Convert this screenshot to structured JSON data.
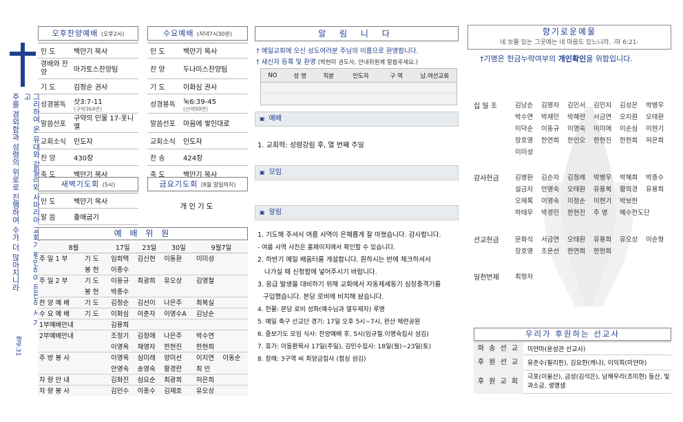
{
  "side": {
    "vertical_lines": [
      "그리하여 온 유대와 갈릴리와 사마리아 교회가 평안하여 든든히 서 가고",
      "주를 경외함과 성령의 위로로 진행하여 수가 더 많아지니라"
    ],
    "verse_ref": "행9:31"
  },
  "afternoon": {
    "title": "오후찬양예배",
    "time": "(오후2시)",
    "rows": [
      {
        "label": "인    도",
        "value": "백만기 목사",
        "sub": ""
      },
      {
        "label": "경배와 찬  양",
        "value": "아가토스찬양팀",
        "sub": ""
      },
      {
        "label": "기    도",
        "value": "김정순 권사",
        "sub": ""
      },
      {
        "label": "성경봉독",
        "value": "삿3:7-11",
        "sub": "(구약364면)"
      },
      {
        "label": "말씀선포",
        "value": "구약의 인물 17-옷니엘",
        "sub": ""
      },
      {
        "label": "교회소식",
        "value": "인도자",
        "sub": ""
      },
      {
        "label": "찬    양",
        "value": "430장",
        "sub": ""
      },
      {
        "label": "축    도",
        "value": "백만기 목사",
        "sub": ""
      }
    ]
  },
  "wednesday": {
    "title": "수요예배",
    "time": "(저녁7시30분)",
    "rows": [
      {
        "label": "인    도",
        "value": "백만기 목사",
        "sub": ""
      },
      {
        "label": "찬    양",
        "value": "두나미스찬양팀",
        "sub": ""
      },
      {
        "label": "기    도",
        "value": "이화심 권사",
        "sub": ""
      },
      {
        "label": "성경봉독",
        "value": "눅6:39-45",
        "sub": "(신약99면)"
      },
      {
        "label": "말씀선포",
        "value": "마음에 쌓인대로",
        "sub": ""
      },
      {
        "label": "교회소식",
        "value": "인도자",
        "sub": ""
      },
      {
        "label": "찬    송",
        "value": "424장",
        "sub": ""
      },
      {
        "label": "축    도",
        "value": "백만기 목사",
        "sub": ""
      }
    ]
  },
  "dawn": {
    "title": "새벽기도회",
    "time": "(5시)",
    "rows": [
      {
        "label": "인    도",
        "value": "백만기 목사"
      },
      {
        "label": "말    씀",
        "value": "출애굽기"
      }
    ]
  },
  "friday": {
    "title": "금요기도회",
    "time": "(8월 말일까지)",
    "text": "개인기도"
  },
  "committee": {
    "title": "예 배 위 원",
    "header": [
      "8월",
      "17일",
      "23일",
      "30일",
      "9월7일"
    ],
    "rows": [
      {
        "role": "주 일 1 부",
        "sub": "기  도",
        "cells": [
          "임희택",
          "김신현",
          "이동환",
          "이미성"
        ]
      },
      {
        "role": "",
        "sub": "봉  헌",
        "cells": [
          "이종수",
          "",
          "",
          ""
        ]
      },
      {
        "role": "주 일 2 부",
        "sub": "기  도",
        "cells": [
          "이동규",
          "최광희",
          "유오상",
          "김영철"
        ]
      },
      {
        "role": "",
        "sub": "봉  헌",
        "cells": [
          "박종수",
          "",
          "",
          ""
        ]
      },
      {
        "role": "찬 양 예 배",
        "sub": "기  도",
        "cells": [
          "김정순",
          "김선이",
          "나은주",
          "최복실"
        ]
      },
      {
        "role": "수 요 예 배",
        "sub": "기  도",
        "cells": [
          "이화심",
          "이춘자",
          "이영수A",
          "김남순"
        ]
      },
      {
        "role": "1부예배안내",
        "sub": "",
        "cells": [
          "김용희",
          "",
          "",
          ""
        ]
      },
      {
        "role": "2부예배안내",
        "sub": "",
        "cells": [
          "조정기",
          "김정애",
          "나은주",
          "박수연"
        ]
      },
      {
        "role": "",
        "sub": "",
        "cells": [
          "이영옥",
          "채영자",
          "한현진",
          "한현희"
        ]
      },
      {
        "role": "주 방 봉 사",
        "sub": "",
        "cells": [
          "이영옥",
          "심미래",
          "양미선",
          "이지연",
          "이동순"
        ]
      },
      {
        "role": "",
        "sub": "",
        "cells": [
          "안영숙",
          "송영숙",
          "황경란",
          "최 인"
        ]
      },
      {
        "role": "차 량 안 내",
        "sub": "",
        "cells": [
          "김화진",
          "심요순",
          "최광희",
          "허은희"
        ]
      },
      {
        "role": "차 량 봉 사",
        "sub": "",
        "cells": [
          "김민수",
          "이종수",
          "김재호",
          "유오상"
        ]
      }
    ]
  },
  "notice": {
    "title": "알 림 니 다",
    "welcome": "예일교회에 오신 성도여러분 주님의 이름으로 환영합니다.",
    "register_prefix": "새신자 등록 및 환영",
    "register_note": "(박현미 권도사, 안내위원께 말씀주세요.)",
    "reg_header": [
      "NO",
      "성 명",
      "직분",
      "인도자",
      "구 역",
      "남.여선교회"
    ],
    "worship_hdr": "예배",
    "worship_items": [
      "1. 교회력: 성령강림 후, 열 번째 주일"
    ],
    "meeting_hdr": "모임",
    "alert_hdr": "알림",
    "alert_items": [
      "1. 기도해 주셔서 여름 사역이 은혜롭게 잘 마쳤습니다. 감사합니다.",
      "  - 여름 사역 사진은 홈페이지에서 확인할 수 있습니다.",
      "2. 하반기 예일 배움터를 개설합니다. 원하시는 반에 체크하셔서",
      "   나가실 때 신청함에 넣어주시기 바랍니다.",
      "3. 응급 발생을 대비하기 위해 교회에서 자동제세동기 심장충격기를",
      "  구입했습니다. 본당 로비에 비치해 놨습니다.",
      "4.  헌물: 본당 로비 성화(예수님과 열두제자) 루명",
      "5. 예일 축구 선교단 경기: 17일 오후 5시~7시, 완산 체련공원",
      "6. 중보기도 모임 식사: 찬양예배 후, 5시(임규철.이명숙집사 섬김)",
      "7. 휴가: 이동환목사 17일(주일), 김민수집사: 18일(월)~23일(토)",
      "8. 장례: 3구역 씨 최양금집사 (점심 섬김)"
    ]
  },
  "offering": {
    "title": "향기로운예물",
    "verse": "네 보물 있는 그곳에는 네 마음도 있느니라. -마 6:21-",
    "notice_prefix": "†기명은 헌금누락여부의 ",
    "notice_bold": "개인확인",
    "notice_suffix": "을 위함입니다.",
    "groups": [
      {
        "label": "십 일 조",
        "names": [
          "김남순",
          "김명자",
          "김민서",
          "김민지",
          "김성은",
          "박병우",
          "박수연",
          "박재민",
          "박혜란",
          "서금연",
          "오지원",
          "오태환",
          "이덕순",
          "이동규",
          "이명숙",
          "이미애",
          "이순심",
          "이현기",
          "장호영",
          "한연희",
          "한인오",
          "한현진",
          "한현희",
          "허은희",
          "이미성"
        ]
      },
      {
        "label": "감사헌금",
        "names": [
          "김병환",
          "김순자",
          "김정례",
          "박병우",
          "박혜희",
          "박종수",
          "설금자",
          "안영숙",
          "오태환",
          "유용복",
          "황의경",
          "유용희",
          "오재록",
          "이영숙",
          "이정순",
          "이현기",
          "박보현",
          "하태우",
          "박경민",
          "한현진",
          "주 영",
          "예수전도단"
        ]
      },
      {
        "label": "선교헌금",
        "names": [
          "문화식",
          "서금연",
          "오태환",
          "유용희",
          "유오상",
          "이순형",
          "장호영",
          "조문선",
          "한연희",
          "한현희"
        ]
      },
      {
        "label": "일천번제",
        "names": [
          "최형자"
        ]
      }
    ]
  },
  "mission": {
    "title": "우리가 후원하는 선교사",
    "rows": [
      {
        "label": "파 송 선 교",
        "value": "미얀마(윤성관 선교사)"
      },
      {
        "label": "후 원 선 교",
        "value": "유준수(필리핀), 김요한(케냐), 이익희(미얀마)"
      },
      {
        "label": "후 원 교 회",
        "value": "극포(이울산), 금성(김석은), 남해우리(조미현) 동산, 빛과소금, 생명샘"
      }
    ]
  }
}
